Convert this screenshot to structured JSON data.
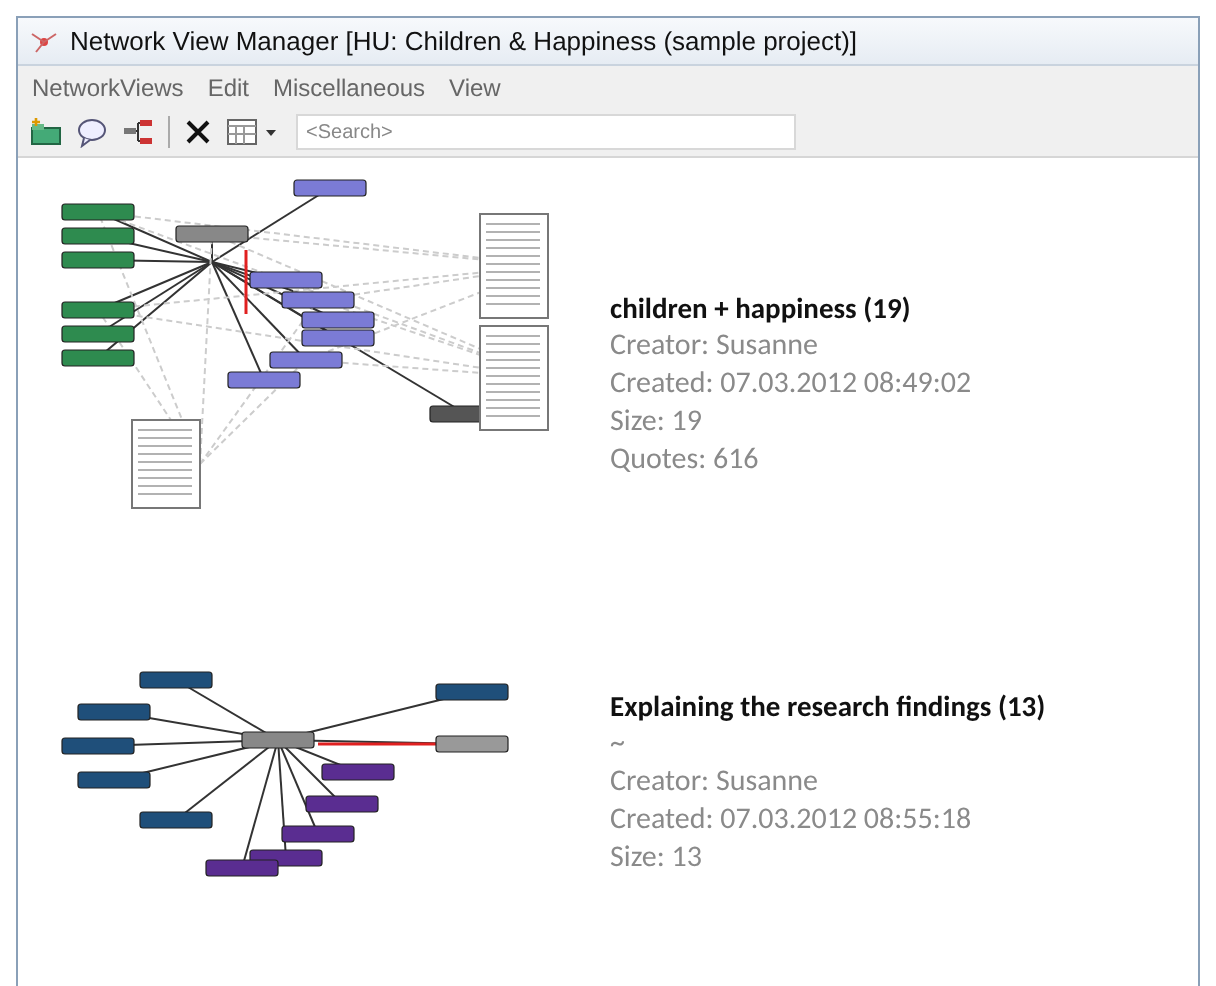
{
  "window": {
    "title": "Network View Manager [HU: Children & Happiness (sample project)]"
  },
  "menu": [
    {
      "label": "NetworkViews"
    },
    {
      "label": "Edit"
    },
    {
      "label": "Miscellaneous"
    },
    {
      "label": "View"
    }
  ],
  "search": {
    "placeholder": "<Search>"
  },
  "views": [
    {
      "title": "children + happiness (19)",
      "details": [
        "Creator: Susanne",
        "Created: 07.03.2012 08:49:02",
        "Size: 19",
        "Quotes: 616"
      ]
    },
    {
      "title": "Explaining the research findings (13)",
      "comment": "~",
      "details": [
        "Creator: Susanne",
        "Created: 07.03.2012 08:55:18",
        "Size: 13"
      ]
    }
  ]
}
